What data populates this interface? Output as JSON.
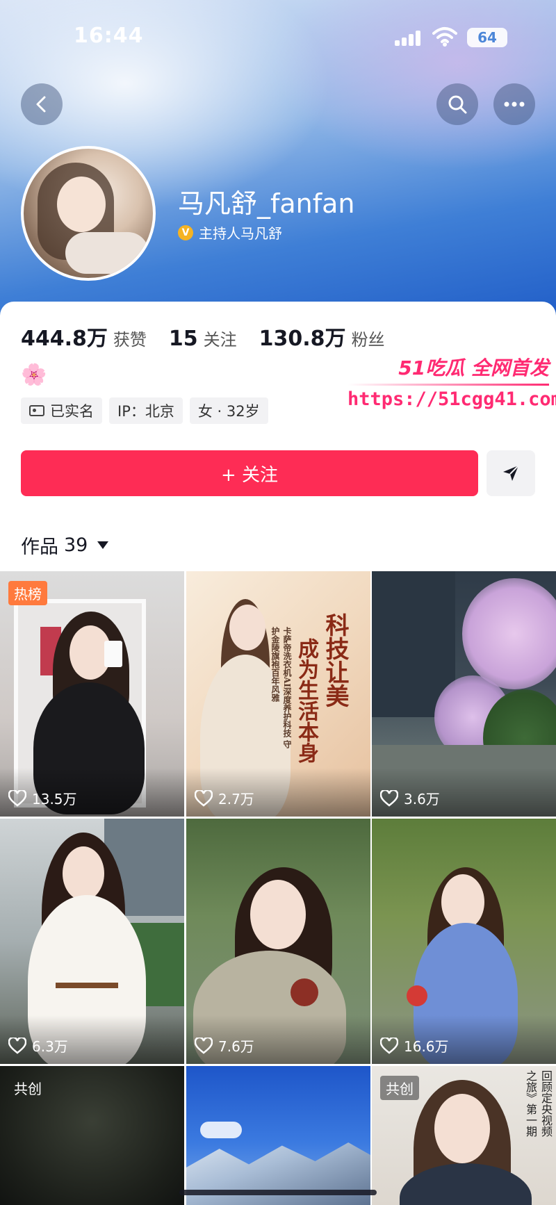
{
  "status_bar": {
    "time": "16:44",
    "battery": "64"
  },
  "profile": {
    "name": "马凡舒_fanfan",
    "verified_label": "主持人马凡舒",
    "stats": [
      {
        "value": "444.8万",
        "label": "获赞"
      },
      {
        "value": "15",
        "label": "关注"
      },
      {
        "value": "130.8万",
        "label": "粉丝"
      }
    ],
    "bio_emoji": "🌸",
    "tags": [
      "已实名",
      "IP：北京",
      "女 · 32岁"
    ]
  },
  "watermark": {
    "title": "51吃瓜 全网首发",
    "url": "https://51cgg41.com"
  },
  "actions": {
    "follow_label": "+ 关注"
  },
  "works": {
    "label": "作品",
    "count": "39"
  },
  "colors": {
    "accent": "#fe2c55",
    "hot_badge": "#ff7a3d",
    "header_blue": "#3f7fd6"
  },
  "grid": [
    {
      "likes": "13.5万",
      "badge": "热榜"
    },
    {
      "likes": "2.7万",
      "badge": "",
      "poster_title": "科技让美",
      "poster_subtitle": "成为生活本身",
      "poster_small": "卡萨帝洗衣机AI深度养护科技 守护金陵旗袍百年风雅"
    },
    {
      "likes": "3.6万",
      "badge": ""
    },
    {
      "likes": "6.3万",
      "badge": ""
    },
    {
      "likes": "7.6万",
      "badge": ""
    },
    {
      "likes": "16.6万",
      "badge": ""
    },
    {
      "likes": "",
      "badge": "共创"
    },
    {
      "likes": "",
      "badge": ""
    },
    {
      "likes": "",
      "badge": "共创",
      "side_text_1": "回顾定央视频",
      "side_text_2": "之旅》第一期"
    }
  ]
}
